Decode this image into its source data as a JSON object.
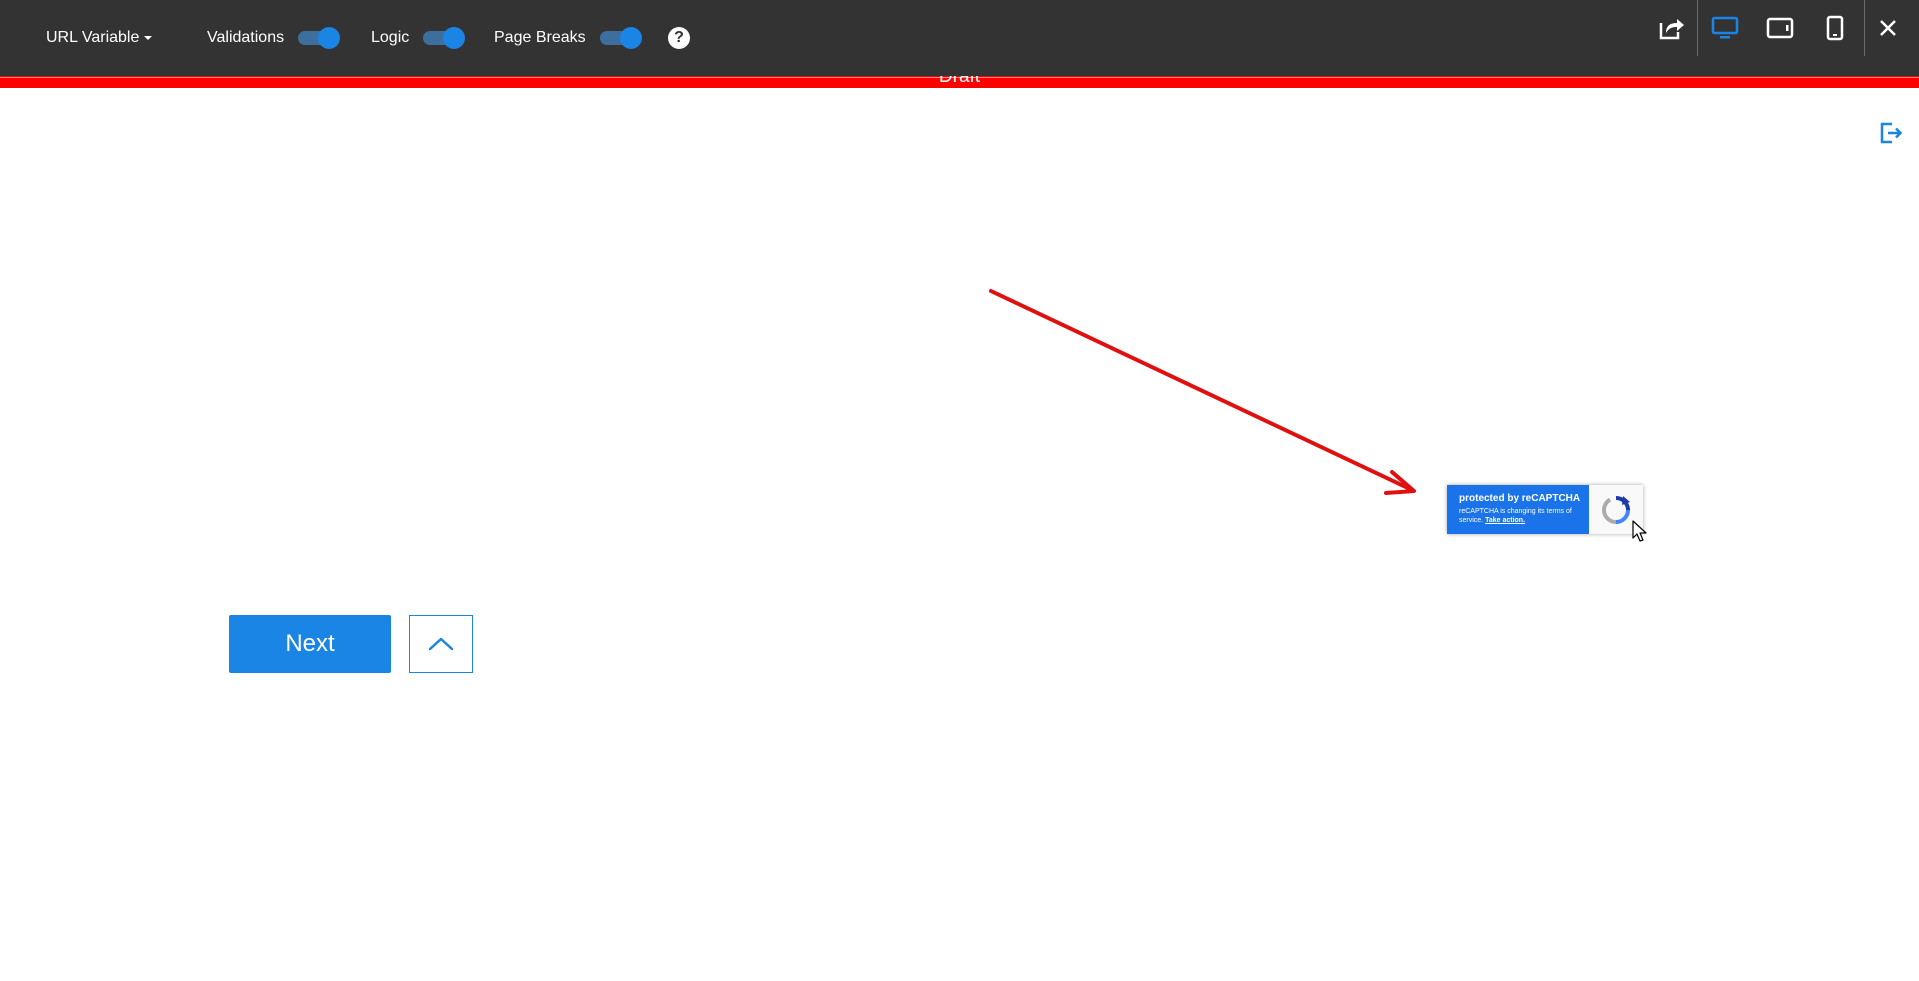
{
  "toolbar": {
    "url_variable_label": "URL Variable",
    "toggles": [
      {
        "label": "Validations",
        "on": true
      },
      {
        "label": "Logic",
        "on": true
      },
      {
        "label": "Page Breaks",
        "on": true
      }
    ],
    "help_label": "?",
    "icons": {
      "share": "share-icon",
      "desktop": "desktop-icon",
      "tablet": "tablet-icon",
      "mobile": "mobile-icon",
      "close": "close-icon",
      "exit": "exit-icon"
    },
    "active_device": "desktop"
  },
  "status": {
    "draft_label": "Draft"
  },
  "recaptcha": {
    "title": "protected by reCAPTCHA",
    "line1": "reCAPTCHA is changing its terms of",
    "line2": "service.",
    "link": "Take action."
  },
  "form": {
    "next_label": "Next",
    "up_icon": "chevron-up-icon"
  },
  "colors": {
    "toolbar_bg": "#333333",
    "accent": "#1a85e5",
    "draft_bar": "#ff0000",
    "annotation_arrow": "#e11010",
    "recaptcha_blue": "#1a73e8"
  }
}
